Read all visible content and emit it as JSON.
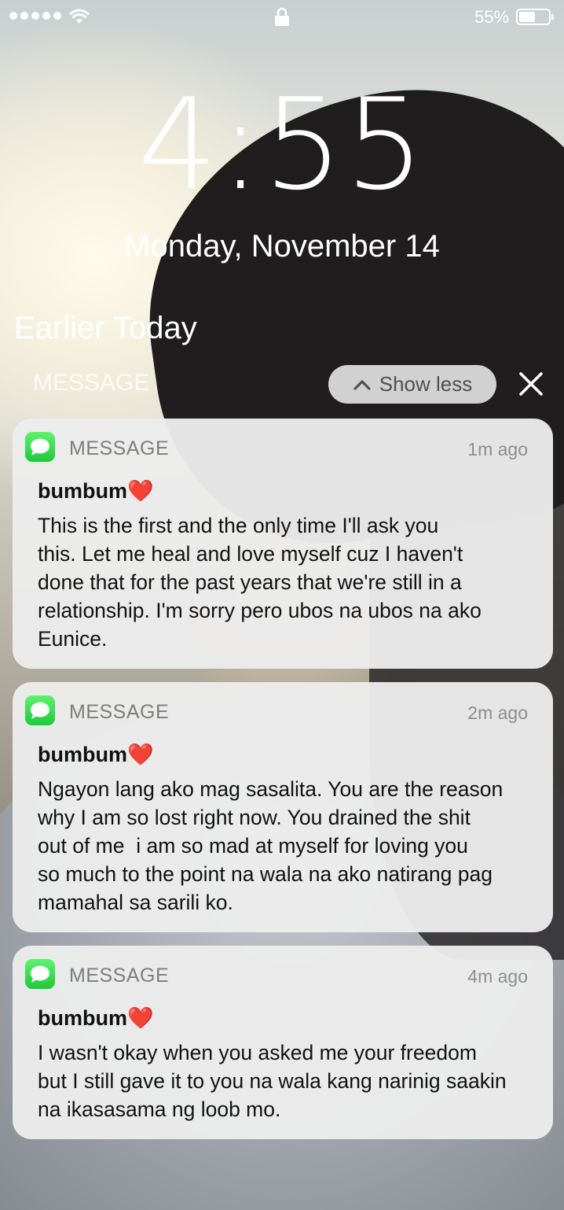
{
  "status_bar": {
    "battery_percent": "55%",
    "battery_level": 0.55
  },
  "lock_screen": {
    "time": "4:55",
    "date": "Monday, November 14"
  },
  "notifications": {
    "section_title": "Earlier Today",
    "group_label": "MESSAGE",
    "show_less_label": "Show less",
    "items": [
      {
        "app": "MESSAGE",
        "time": "1m ago",
        "sender": "bumbum❤️",
        "lines": [
          "This is the first and the only time I'll ask you",
          "this. Let me heal and love myself cuz I haven't",
          "done that for the past years that we're still in a",
          "relationship. I'm sorry pero ubos na ubos na ako",
          "Eunice."
        ]
      },
      {
        "app": "MESSAGE",
        "time": "2m ago",
        "sender": "bumbum❤️",
        "lines": [
          "Ngayon lang ako mag sasalita. You are the reason",
          "why I am so lost right now. You drained the shit",
          "out of me  i am so mad at myself for loving you",
          "so much to the point na wala na ako natirang pag",
          "mamahal sa sarili ko."
        ]
      },
      {
        "app": "MESSAGE",
        "time": "4m ago",
        "sender": "bumbum❤️",
        "lines": [
          "I wasn't okay when you asked me your freedom",
          "but I still gave it to you na wala kang narinig saakin",
          "na ikasasama ng loob mo."
        ]
      }
    ]
  },
  "icons": {
    "app_icon": "messages-icon",
    "status": [
      "signal-icon",
      "wifi-icon",
      "lock-icon",
      "battery-icon"
    ],
    "chevron": "chevron-up-icon",
    "close": "close-icon"
  },
  "colors": {
    "messages_green": "#2bd14a",
    "card_bg": "#ececec",
    "text_dark": "#111111",
    "text_muted": "#8d8d8d"
  }
}
